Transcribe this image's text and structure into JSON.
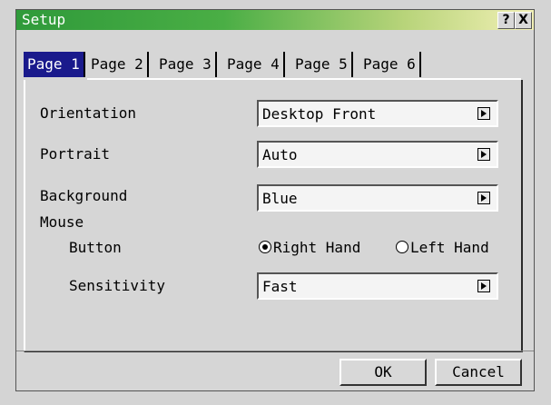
{
  "window": {
    "title": "Setup",
    "help_label": "?",
    "close_label": "X"
  },
  "tabs": [
    {
      "label": "Page 1",
      "active": true
    },
    {
      "label": "Page 2",
      "active": false
    },
    {
      "label": "Page 3",
      "active": false
    },
    {
      "label": "Page 4",
      "active": false
    },
    {
      "label": "Page 5",
      "active": false
    },
    {
      "label": "Page 6",
      "active": false
    }
  ],
  "settings": {
    "orientation": {
      "label": "Orientation",
      "value": "Desktop Front"
    },
    "portrait": {
      "label": "Portrait",
      "value": "Auto"
    },
    "background": {
      "label": "Background",
      "value": "Blue"
    },
    "mouse": {
      "label": "Mouse",
      "button_label": "Button",
      "right_hand": "Right Hand",
      "left_hand": "Left Hand",
      "selected": "right",
      "sensitivity_label": "Sensitivity",
      "sensitivity_value": "Fast"
    }
  },
  "footer": {
    "ok_label": "OK",
    "cancel_label": "Cancel"
  },
  "colors": {
    "active_tab": "#1a1a8c",
    "title_bar_start": "#2f9a3a",
    "title_bar_end": "#f2f0b6"
  }
}
